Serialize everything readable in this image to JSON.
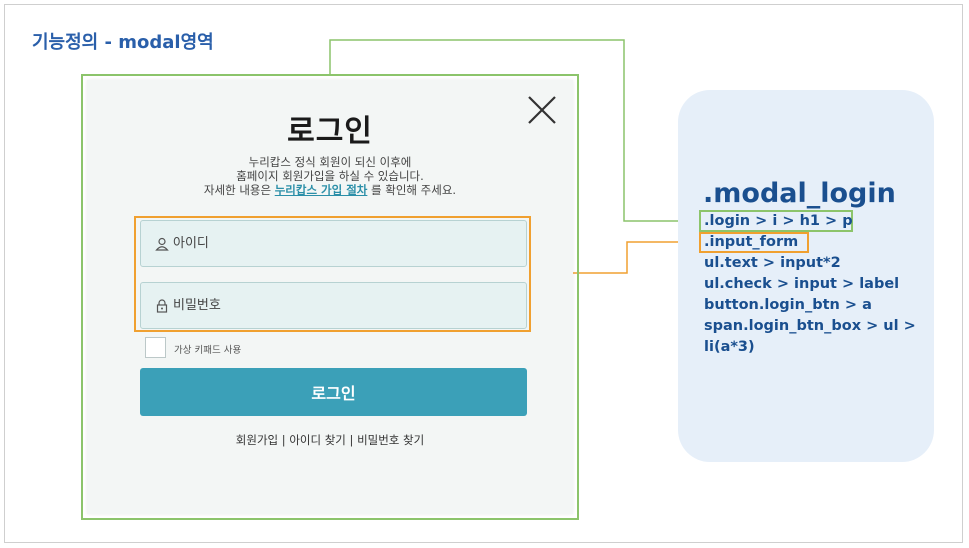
{
  "page": {
    "title": "기능정의 - modal영역"
  },
  "modal": {
    "title": "로그인",
    "desc_line1": "누리캅스 정식 회원이 되신 이후에",
    "desc_line2": "홈페이지 회원가입을 하실 수 있습니다.",
    "desc_line3_prefix": "자세한 내용은",
    "desc_line3_link": "누리캅스 가입 절차",
    "desc_line3_suffix": "를 확인해 주세요.",
    "id_placeholder": "아이디",
    "pw_placeholder": "비밀번호",
    "checkbox_label": "가상 키패드 사용",
    "login_button": "로그인",
    "links": {
      "signup": "회원가입",
      "find_id": "아이디 찾기",
      "find_pw": "비밀번호 찾기",
      "sep1": "|",
      "sep2": "|"
    }
  },
  "annotation": {
    "title": ".modal_login",
    "lines": [
      ".login > i > h1 > p",
      ".input_form",
      "ul.text > input*2",
      "ul.check > input  > label",
      "button.login_btn > a",
      "span.login_btn_box > ul >",
      "li(a*3)"
    ]
  },
  "colors": {
    "green_outline": "#8cc46b",
    "orange_outline": "#f0a030",
    "accent_button": "#3ba0b8",
    "annotation_text": "#1a4f8f",
    "annotation_bg": "#e6eff9"
  }
}
